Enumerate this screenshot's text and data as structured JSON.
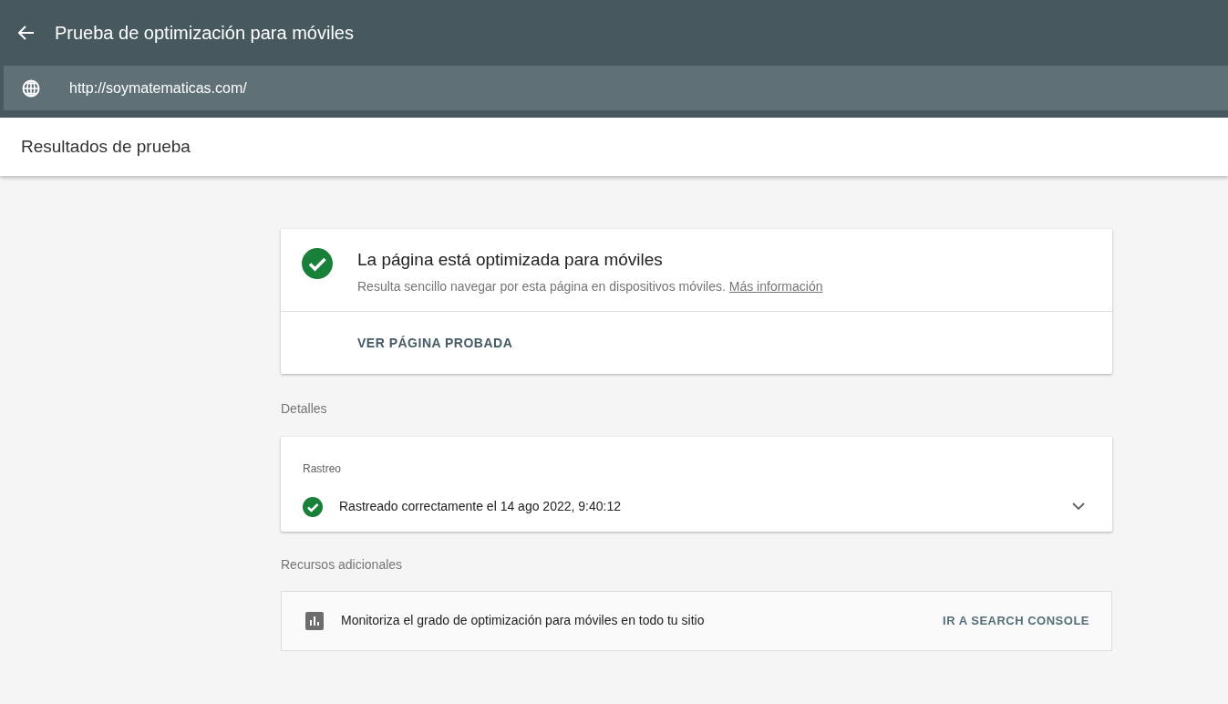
{
  "app_bar": {
    "title": "Prueba de optimización para móviles",
    "url": "http://soymatematicas.com/"
  },
  "results_bar": {
    "title": "Resultados de prueba"
  },
  "verdict": {
    "title": "La página está optimizada para móviles",
    "description": "Resulta sencillo navegar por esta página en dispositivos móviles.",
    "link": "Más información",
    "action": "VER PÁGINA PROBADA"
  },
  "details": {
    "heading": "Detalles",
    "section": "Rastreo",
    "status": "Rastreado correctamente el 14 ago 2022, 9:40:12",
    "expanded": false
  },
  "resources": {
    "heading": "Recursos adicionales",
    "text": "Monitoriza el grado de optimización para móviles en todo tu sitio",
    "action": "IR A SEARCH CONSOLE"
  }
}
